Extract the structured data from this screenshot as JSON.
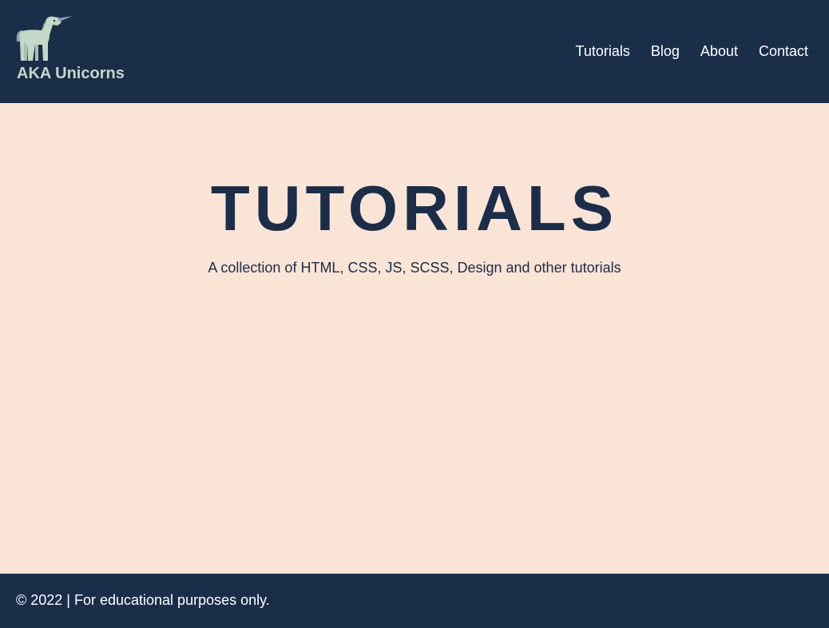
{
  "header": {
    "logo_icon": "unicorn-icon",
    "logo_text": "AKA Unicorns",
    "nav": [
      {
        "label": "Tutorials"
      },
      {
        "label": "Blog"
      },
      {
        "label": "About"
      },
      {
        "label": "Contact"
      }
    ]
  },
  "hero": {
    "title": "TUTORIALS",
    "subtitle": "A collection of HTML, CSS, JS, SCSS, Design and other tutorials"
  },
  "footer": {
    "text": "© 2022 | For educational purposes only."
  },
  "colors": {
    "navy": "#1a2e4a",
    "background": "#fae4d6",
    "logo_mint": "#c4d8c7",
    "horn": "#8fa3ad"
  }
}
